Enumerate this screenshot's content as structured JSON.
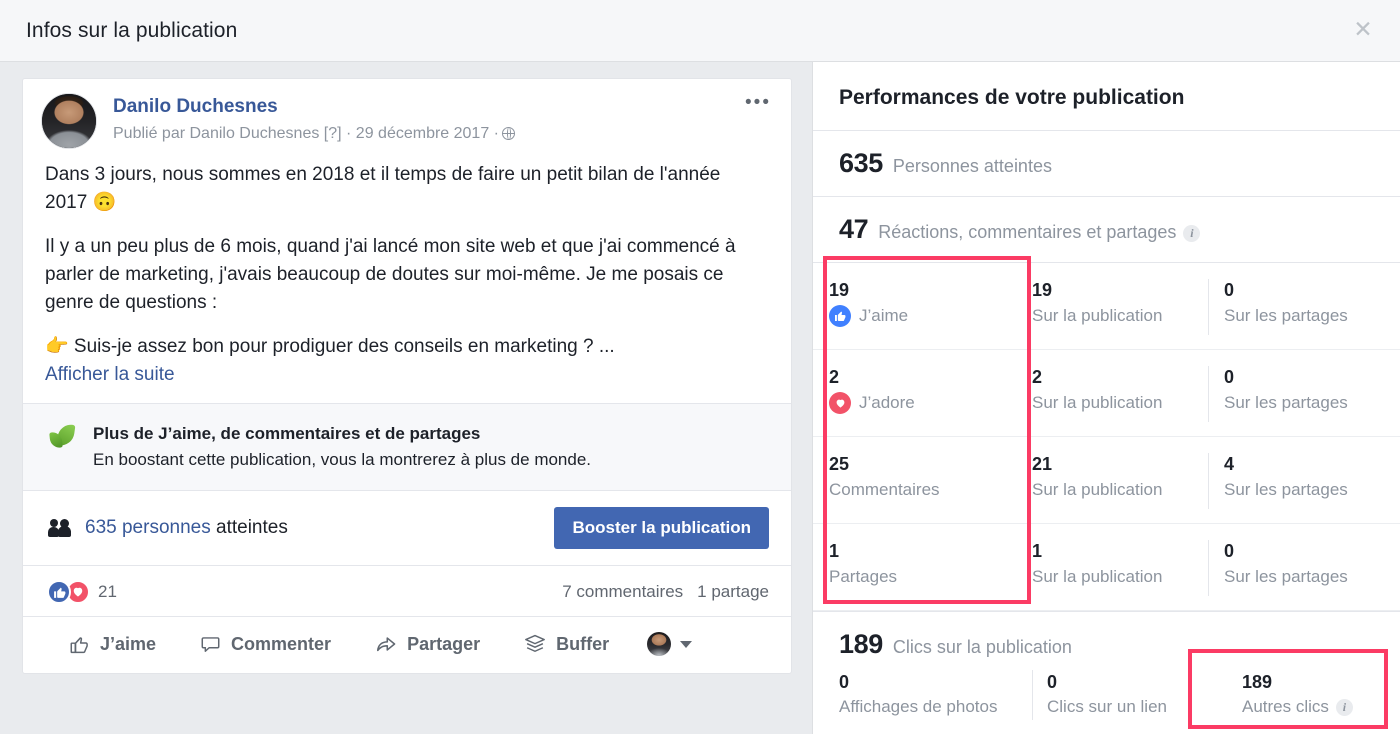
{
  "dialog": {
    "title": "Infos sur la publication",
    "close_icon": "close-icon"
  },
  "post": {
    "author": "Danilo Duchesnes",
    "meta": "Publié par Danilo Duchesnes [?] · 29 décembre 2017 ·",
    "menu_icon": "ellipsis-icon",
    "privacy_icon": "globe-icon",
    "paragraphs": [
      "Dans 3 jours, nous sommes en 2018 et il temps de faire un petit bilan de l'année 2017 🙃",
      "Il y a un peu plus de 6 mois, quand j'ai lancé mon site web et que j'ai commencé à parler de marketing, j'avais beaucoup de doutes sur moi-même. Je me posais ce genre de questions :",
      "👉 Suis-je assez bon pour prodiguer des conseils en marketing ? ..."
    ],
    "see_more": "Afficher la suite"
  },
  "boost_promo": {
    "icon": "leaf-icon",
    "title": "Plus de J’aime, de commentaires et de partages",
    "subtitle": "En boostant cette publication, vous la montrerez à plus de monde."
  },
  "reach": {
    "icon": "people-icon",
    "link_text": "635 personnes",
    "suffix": " atteintes",
    "boost_button": "Booster la publication"
  },
  "engagement": {
    "like_icon": "thumbs-up-icon",
    "love_icon": "heart-icon",
    "reaction_count": "21",
    "comments": "7 commentaires",
    "shares": "1 partage"
  },
  "actions": [
    {
      "icon": "thumbs-up-outline-icon",
      "label": "J’aime"
    },
    {
      "icon": "comment-bubble-icon",
      "label": "Commenter"
    },
    {
      "icon": "share-arrow-icon",
      "label": "Partager"
    },
    {
      "icon": "buffer-stack-icon",
      "label": "Buffer"
    }
  ],
  "action_extras": {
    "avatar": "buffer-account-avatar",
    "caret": "chevron-down-icon"
  },
  "panel": {
    "title": "Performances de votre publication",
    "reach": {
      "value": "635",
      "label": "Personnes atteintes"
    },
    "engagement": {
      "value": "47",
      "label": "Réactions, commentaires et partages",
      "info_icon": "info-icon"
    },
    "reaction_rows": [
      {
        "icon": "thumbs-up-icon",
        "count": "19",
        "type": "J’aime",
        "on_post_count": "19",
        "on_post_label": "Sur la publication",
        "on_shares_count": "0",
        "on_shares_label": "Sur les partages"
      },
      {
        "icon": "heart-icon",
        "count": "2",
        "type": "J’adore",
        "on_post_count": "2",
        "on_post_label": "Sur la publication",
        "on_shares_count": "0",
        "on_shares_label": "Sur les partages"
      },
      {
        "icon": "none",
        "count": "25",
        "type": "Commentaires",
        "on_post_count": "21",
        "on_post_label": "Sur la publication",
        "on_shares_count": "4",
        "on_shares_label": "Sur les partages"
      },
      {
        "icon": "none",
        "count": "1",
        "type": "Partages",
        "on_post_count": "1",
        "on_post_label": "Sur la publication",
        "on_shares_count": "0",
        "on_shares_label": "Sur les partages"
      }
    ],
    "clicks": {
      "value": "189",
      "label": "Clics sur la publication",
      "photo_views": {
        "value": "0",
        "label": "Affichages de photos"
      },
      "link_clicks": {
        "value": "0",
        "label": "Clics sur un lien"
      },
      "other_clicks": {
        "value": "189",
        "label": "Autres clics",
        "info_icon": "info-icon"
      }
    }
  },
  "highlights": {
    "color": "#fb3b64",
    "boxes": [
      "reaction-type-column",
      "other-clicks-stat"
    ]
  }
}
